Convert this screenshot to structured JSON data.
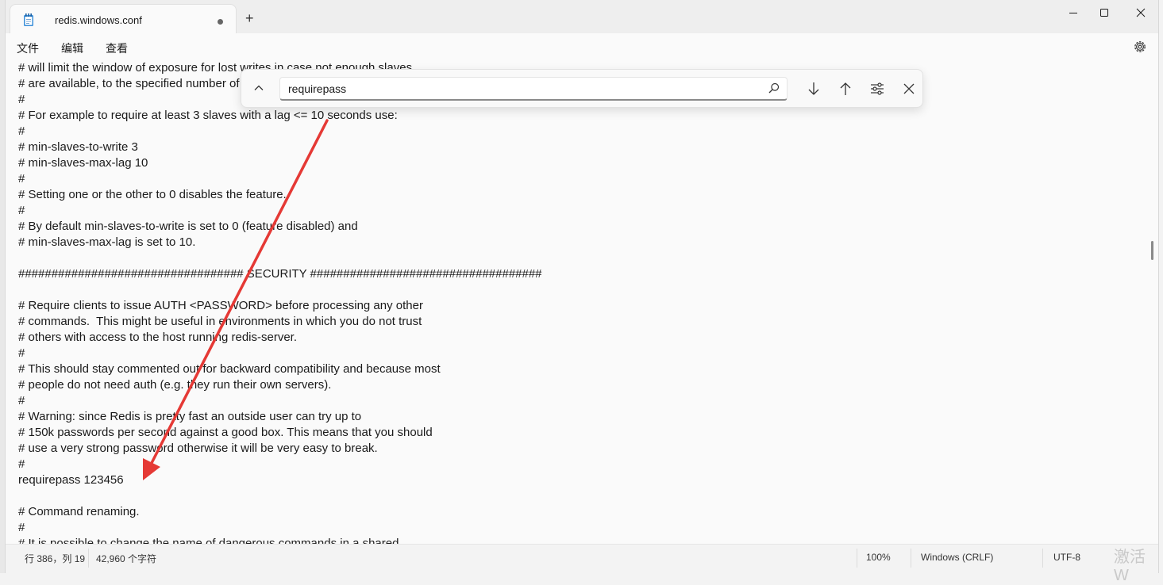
{
  "tab": {
    "title": "redis.windows.conf",
    "new_tab_symbol": "+"
  },
  "window_controls": [
    "minimize-icon",
    "maximize-icon",
    "close-icon"
  ],
  "menu": {
    "items": [
      "文件",
      "编辑",
      "查看"
    ],
    "settings_icon": "gear-icon"
  },
  "find": {
    "value": "requirepass",
    "icons": [
      "chevron-up-icon",
      "search-icon",
      "arrow-down-icon",
      "arrow-up-icon",
      "options-icon",
      "close-icon"
    ]
  },
  "editor": {
    "lines": [
      "# will limit the window of exposure for lost writes in case not enough slaves",
      "# are available, to the specified number of seconds.",
      "#",
      "# For example to require at least 3 slaves with a lag <= 10 seconds use:",
      "#",
      "# min-slaves-to-write 3",
      "# min-slaves-max-lag 10",
      "#",
      "# Setting one or the other to 0 disables the feature.",
      "#",
      "# By default min-slaves-to-write is set to 0 (feature disabled) and",
      "# min-slaves-max-lag is set to 10.",
      "",
      "################################## SECURITY ###################################",
      "",
      "# Require clients to issue AUTH <PASSWORD> before processing any other",
      "# commands.  This might be useful in environments in which you do not trust",
      "# others with access to the host running redis-server.",
      "#",
      "# This should stay commented out for backward compatibility and because most",
      "# people do not need auth (e.g. they run their own servers).",
      "#",
      "# Warning: since Redis is pretty fast an outside user can try up to",
      "# 150k passwords per second against a good box. This means that you should",
      "# use a very strong password otherwise it will be very easy to break.",
      "#",
      "requirepass 123456",
      "",
      "# Command renaming.",
      "#",
      "# It is possible to change the name of dangerous commands in a shared"
    ]
  },
  "status": {
    "position": "行 386，列 19",
    "char_count": "42,960 个字符",
    "zoom": "100%",
    "line_ending": "Windows (CRLF)",
    "encoding": "UTF-8"
  },
  "watermark": "激活 W",
  "colors": {
    "annotation_arrow": "#e53935",
    "accent": "#005fb8"
  }
}
